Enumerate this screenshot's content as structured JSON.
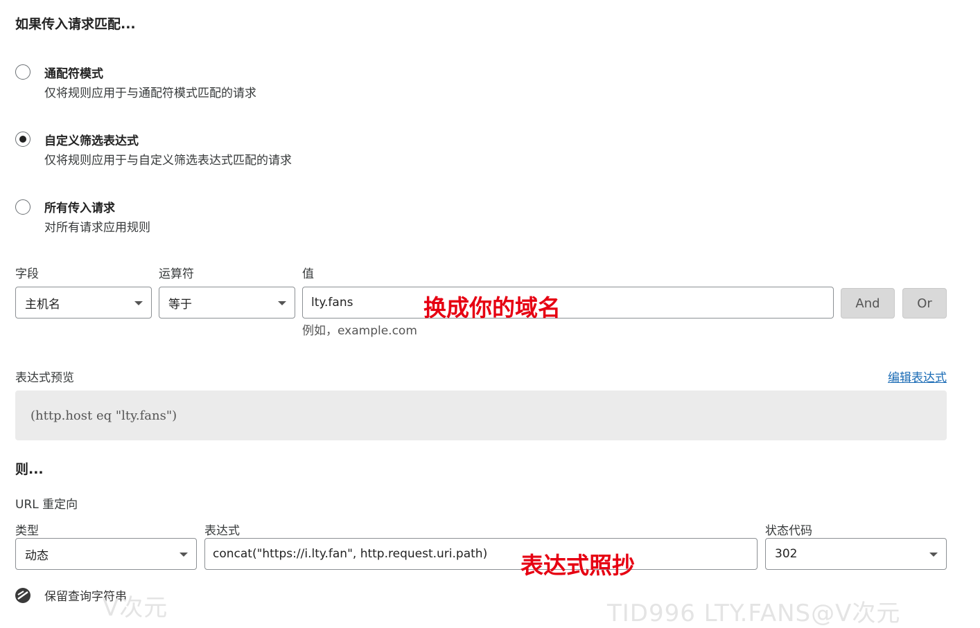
{
  "match_section": {
    "title": "如果传入请求匹配...",
    "options": [
      {
        "title": "通配符模式",
        "desc": "仅将规则应用于与通配符模式匹配的请求",
        "checked": false
      },
      {
        "title": "自定义筛选表达式",
        "desc": "仅将规则应用于与自定义筛选表达式匹配的请求",
        "checked": true
      },
      {
        "title": "所有传入请求",
        "desc": "对所有请求应用规则",
        "checked": false
      }
    ]
  },
  "filter": {
    "field_label": "字段",
    "operator_label": "运算符",
    "value_label": "值",
    "field_value": "主机名",
    "operator_value": "等于",
    "value_value": "lty.fans",
    "value_hint": "例如，example.com",
    "and_label": "And",
    "or_label": "Or"
  },
  "annotations": {
    "domain_note": "换成你的域名",
    "expr_note": "表达式照抄"
  },
  "preview": {
    "label": "表达式预览",
    "edit_link": "编辑表达式",
    "expression": "(http.host eq \"lty.fans\")"
  },
  "then_section": {
    "title": "则...",
    "action": "URL 重定向",
    "type_label": "类型",
    "type_value": "动态",
    "expression_label": "表达式",
    "expression_value": "concat(\"https://i.lty.fan\", http.request.uri.path)",
    "status_label": "状态代码",
    "status_value": "302",
    "preserve_query_label": "保留查询字符串"
  },
  "watermarks": {
    "left": "V次元",
    "right": "TID996 LTY.FANS@V次元"
  }
}
